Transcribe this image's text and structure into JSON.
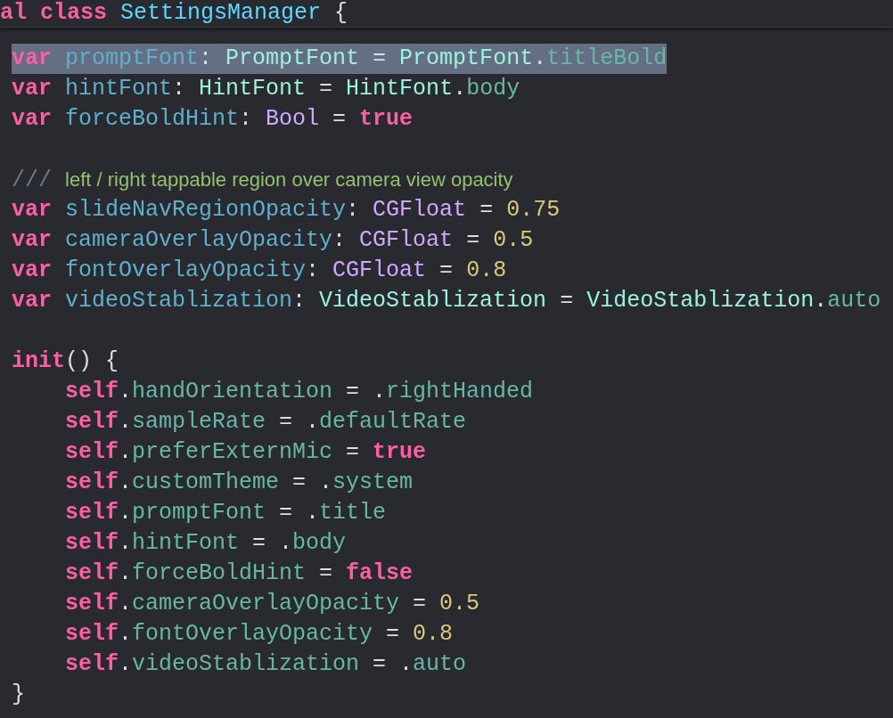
{
  "sticky_header": {
    "tokens": [
      {
        "kind": "keyword",
        "text": "al class "
      },
      {
        "kind": "class",
        "text": "SettingsManager"
      },
      {
        "kind": "plain",
        "text": " {"
      }
    ]
  },
  "lines": [
    {
      "kind": "code",
      "selected": true,
      "tokens": [
        {
          "kind": "keyword",
          "text": "var "
        },
        {
          "kind": "decl",
          "text": "promptFont"
        },
        {
          "kind": "plain",
          "text": ": "
        },
        {
          "kind": "type",
          "text": "PromptFont"
        },
        {
          "kind": "plain",
          "text": " = "
        },
        {
          "kind": "type",
          "text": "PromptFont"
        },
        {
          "kind": "plain",
          "text": "."
        },
        {
          "kind": "member",
          "text": "titleBold"
        }
      ]
    },
    {
      "kind": "code",
      "selected": false,
      "tokens": [
        {
          "kind": "keyword",
          "text": "var "
        },
        {
          "kind": "decl",
          "text": "hintFont"
        },
        {
          "kind": "plain",
          "text": ": "
        },
        {
          "kind": "type",
          "text": "HintFont"
        },
        {
          "kind": "plain",
          "text": " = "
        },
        {
          "kind": "type",
          "text": "HintFont"
        },
        {
          "kind": "plain",
          "text": "."
        },
        {
          "kind": "member",
          "text": "body"
        }
      ]
    },
    {
      "kind": "code",
      "selected": false,
      "tokens": [
        {
          "kind": "keyword",
          "text": "var "
        },
        {
          "kind": "decl",
          "text": "forceBoldHint"
        },
        {
          "kind": "plain",
          "text": ": "
        },
        {
          "kind": "systype",
          "text": "Bool"
        },
        {
          "kind": "plain",
          "text": " = "
        },
        {
          "kind": "keyword",
          "text": "true"
        }
      ]
    },
    {
      "kind": "blank"
    },
    {
      "kind": "code",
      "selected": false,
      "tokens": [
        {
          "kind": "doc-marker",
          "text": "/// "
        },
        {
          "kind": "doc",
          "text": "left / right tappable region over camera view opacity"
        }
      ]
    },
    {
      "kind": "code",
      "selected": false,
      "tokens": [
        {
          "kind": "keyword",
          "text": "var "
        },
        {
          "kind": "decl",
          "text": "slideNavRegionOpacity"
        },
        {
          "kind": "plain",
          "text": ": "
        },
        {
          "kind": "systype",
          "text": "CGFloat"
        },
        {
          "kind": "plain",
          "text": " = "
        },
        {
          "kind": "number",
          "text": "0.75"
        }
      ]
    },
    {
      "kind": "code",
      "selected": false,
      "tokens": [
        {
          "kind": "keyword",
          "text": "var "
        },
        {
          "kind": "decl",
          "text": "cameraOverlayOpacity"
        },
        {
          "kind": "plain",
          "text": ": "
        },
        {
          "kind": "systype",
          "text": "CGFloat"
        },
        {
          "kind": "plain",
          "text": " = "
        },
        {
          "kind": "number",
          "text": "0.5"
        }
      ]
    },
    {
      "kind": "code",
      "selected": false,
      "tokens": [
        {
          "kind": "keyword",
          "text": "var "
        },
        {
          "kind": "decl",
          "text": "fontOverlayOpacity"
        },
        {
          "kind": "plain",
          "text": ": "
        },
        {
          "kind": "systype",
          "text": "CGFloat"
        },
        {
          "kind": "plain",
          "text": " = "
        },
        {
          "kind": "number",
          "text": "0.8"
        }
      ]
    },
    {
      "kind": "code",
      "selected": false,
      "tokens": [
        {
          "kind": "keyword",
          "text": "var "
        },
        {
          "kind": "decl",
          "text": "videoStablization"
        },
        {
          "kind": "plain",
          "text": ": "
        },
        {
          "kind": "type",
          "text": "VideoStablization"
        },
        {
          "kind": "plain",
          "text": " = "
        },
        {
          "kind": "type",
          "text": "VideoStablization"
        },
        {
          "kind": "plain",
          "text": "."
        },
        {
          "kind": "member",
          "text": "auto"
        }
      ]
    },
    {
      "kind": "blank"
    },
    {
      "kind": "code",
      "selected": false,
      "tokens": [
        {
          "kind": "keyword",
          "text": "init"
        },
        {
          "kind": "plain",
          "text": "() {"
        }
      ],
      "children": [
        {
          "kind": "code",
          "selected": false,
          "tokens": [
            {
              "kind": "keyword",
              "text": "self"
            },
            {
              "kind": "plain",
              "text": "."
            },
            {
              "kind": "member",
              "text": "handOrientation"
            },
            {
              "kind": "plain",
              "text": " = ."
            },
            {
              "kind": "member",
              "text": "rightHanded"
            }
          ]
        },
        {
          "kind": "code",
          "selected": false,
          "tokens": [
            {
              "kind": "keyword",
              "text": "self"
            },
            {
              "kind": "plain",
              "text": "."
            },
            {
              "kind": "member",
              "text": "sampleRate"
            },
            {
              "kind": "plain",
              "text": " = ."
            },
            {
              "kind": "member",
              "text": "defaultRate"
            }
          ]
        },
        {
          "kind": "code",
          "selected": false,
          "tokens": [
            {
              "kind": "keyword",
              "text": "self"
            },
            {
              "kind": "plain",
              "text": "."
            },
            {
              "kind": "member",
              "text": "preferExternMic"
            },
            {
              "kind": "plain",
              "text": " = "
            },
            {
              "kind": "keyword",
              "text": "true"
            }
          ]
        },
        {
          "kind": "code",
          "selected": false,
          "tokens": [
            {
              "kind": "keyword",
              "text": "self"
            },
            {
              "kind": "plain",
              "text": "."
            },
            {
              "kind": "member",
              "text": "customTheme"
            },
            {
              "kind": "plain",
              "text": " = ."
            },
            {
              "kind": "member",
              "text": "system"
            }
          ]
        },
        {
          "kind": "code",
          "selected": false,
          "tokens": [
            {
              "kind": "keyword",
              "text": "self"
            },
            {
              "kind": "plain",
              "text": "."
            },
            {
              "kind": "member",
              "text": "promptFont"
            },
            {
              "kind": "plain",
              "text": " = ."
            },
            {
              "kind": "member",
              "text": "title"
            }
          ]
        },
        {
          "kind": "code",
          "selected": false,
          "tokens": [
            {
              "kind": "keyword",
              "text": "self"
            },
            {
              "kind": "plain",
              "text": "."
            },
            {
              "kind": "member",
              "text": "hintFont"
            },
            {
              "kind": "plain",
              "text": " = ."
            },
            {
              "kind": "member",
              "text": "body"
            }
          ]
        },
        {
          "kind": "code",
          "selected": false,
          "tokens": [
            {
              "kind": "keyword",
              "text": "self"
            },
            {
              "kind": "plain",
              "text": "."
            },
            {
              "kind": "member",
              "text": "forceBoldHint"
            },
            {
              "kind": "plain",
              "text": " = "
            },
            {
              "kind": "keyword",
              "text": "false"
            }
          ]
        },
        {
          "kind": "code",
          "selected": false,
          "tokens": [
            {
              "kind": "keyword",
              "text": "self"
            },
            {
              "kind": "plain",
              "text": "."
            },
            {
              "kind": "member",
              "text": "cameraOverlayOpacity"
            },
            {
              "kind": "plain",
              "text": " = "
            },
            {
              "kind": "number",
              "text": "0.5"
            }
          ]
        },
        {
          "kind": "code",
          "selected": false,
          "tokens": [
            {
              "kind": "keyword",
              "text": "self"
            },
            {
              "kind": "plain",
              "text": "."
            },
            {
              "kind": "member",
              "text": "fontOverlayOpacity"
            },
            {
              "kind": "plain",
              "text": " = "
            },
            {
              "kind": "number",
              "text": "0.8"
            }
          ]
        },
        {
          "kind": "code",
          "selected": false,
          "tokens": [
            {
              "kind": "keyword",
              "text": "self"
            },
            {
              "kind": "plain",
              "text": "."
            },
            {
              "kind": "member",
              "text": "videoStablization"
            },
            {
              "kind": "plain",
              "text": " = ."
            },
            {
              "kind": "member",
              "text": "auto"
            }
          ]
        }
      ]
    },
    {
      "kind": "code",
      "selected": false,
      "tokens": [
        {
          "kind": "plain",
          "text": "}"
        }
      ]
    }
  ]
}
